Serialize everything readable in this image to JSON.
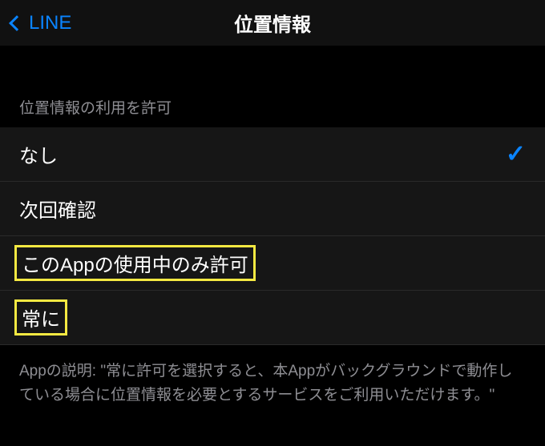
{
  "nav": {
    "back_label": "LINE",
    "title": "位置情報"
  },
  "section": {
    "header": "位置情報の利用を許可"
  },
  "options": [
    {
      "label": "なし",
      "selected": true,
      "highlighted": false
    },
    {
      "label": "次回確認",
      "selected": false,
      "highlighted": false
    },
    {
      "label": "このAppの使用中のみ許可",
      "selected": false,
      "highlighted": true
    },
    {
      "label": "常に",
      "selected": false,
      "highlighted": true
    }
  ],
  "footer": "Appの説明: \"常に許可を選択すると、本Appがバックグラウンドで動作している場合に位置情報を必要とするサービスをご利用いただけます。\""
}
